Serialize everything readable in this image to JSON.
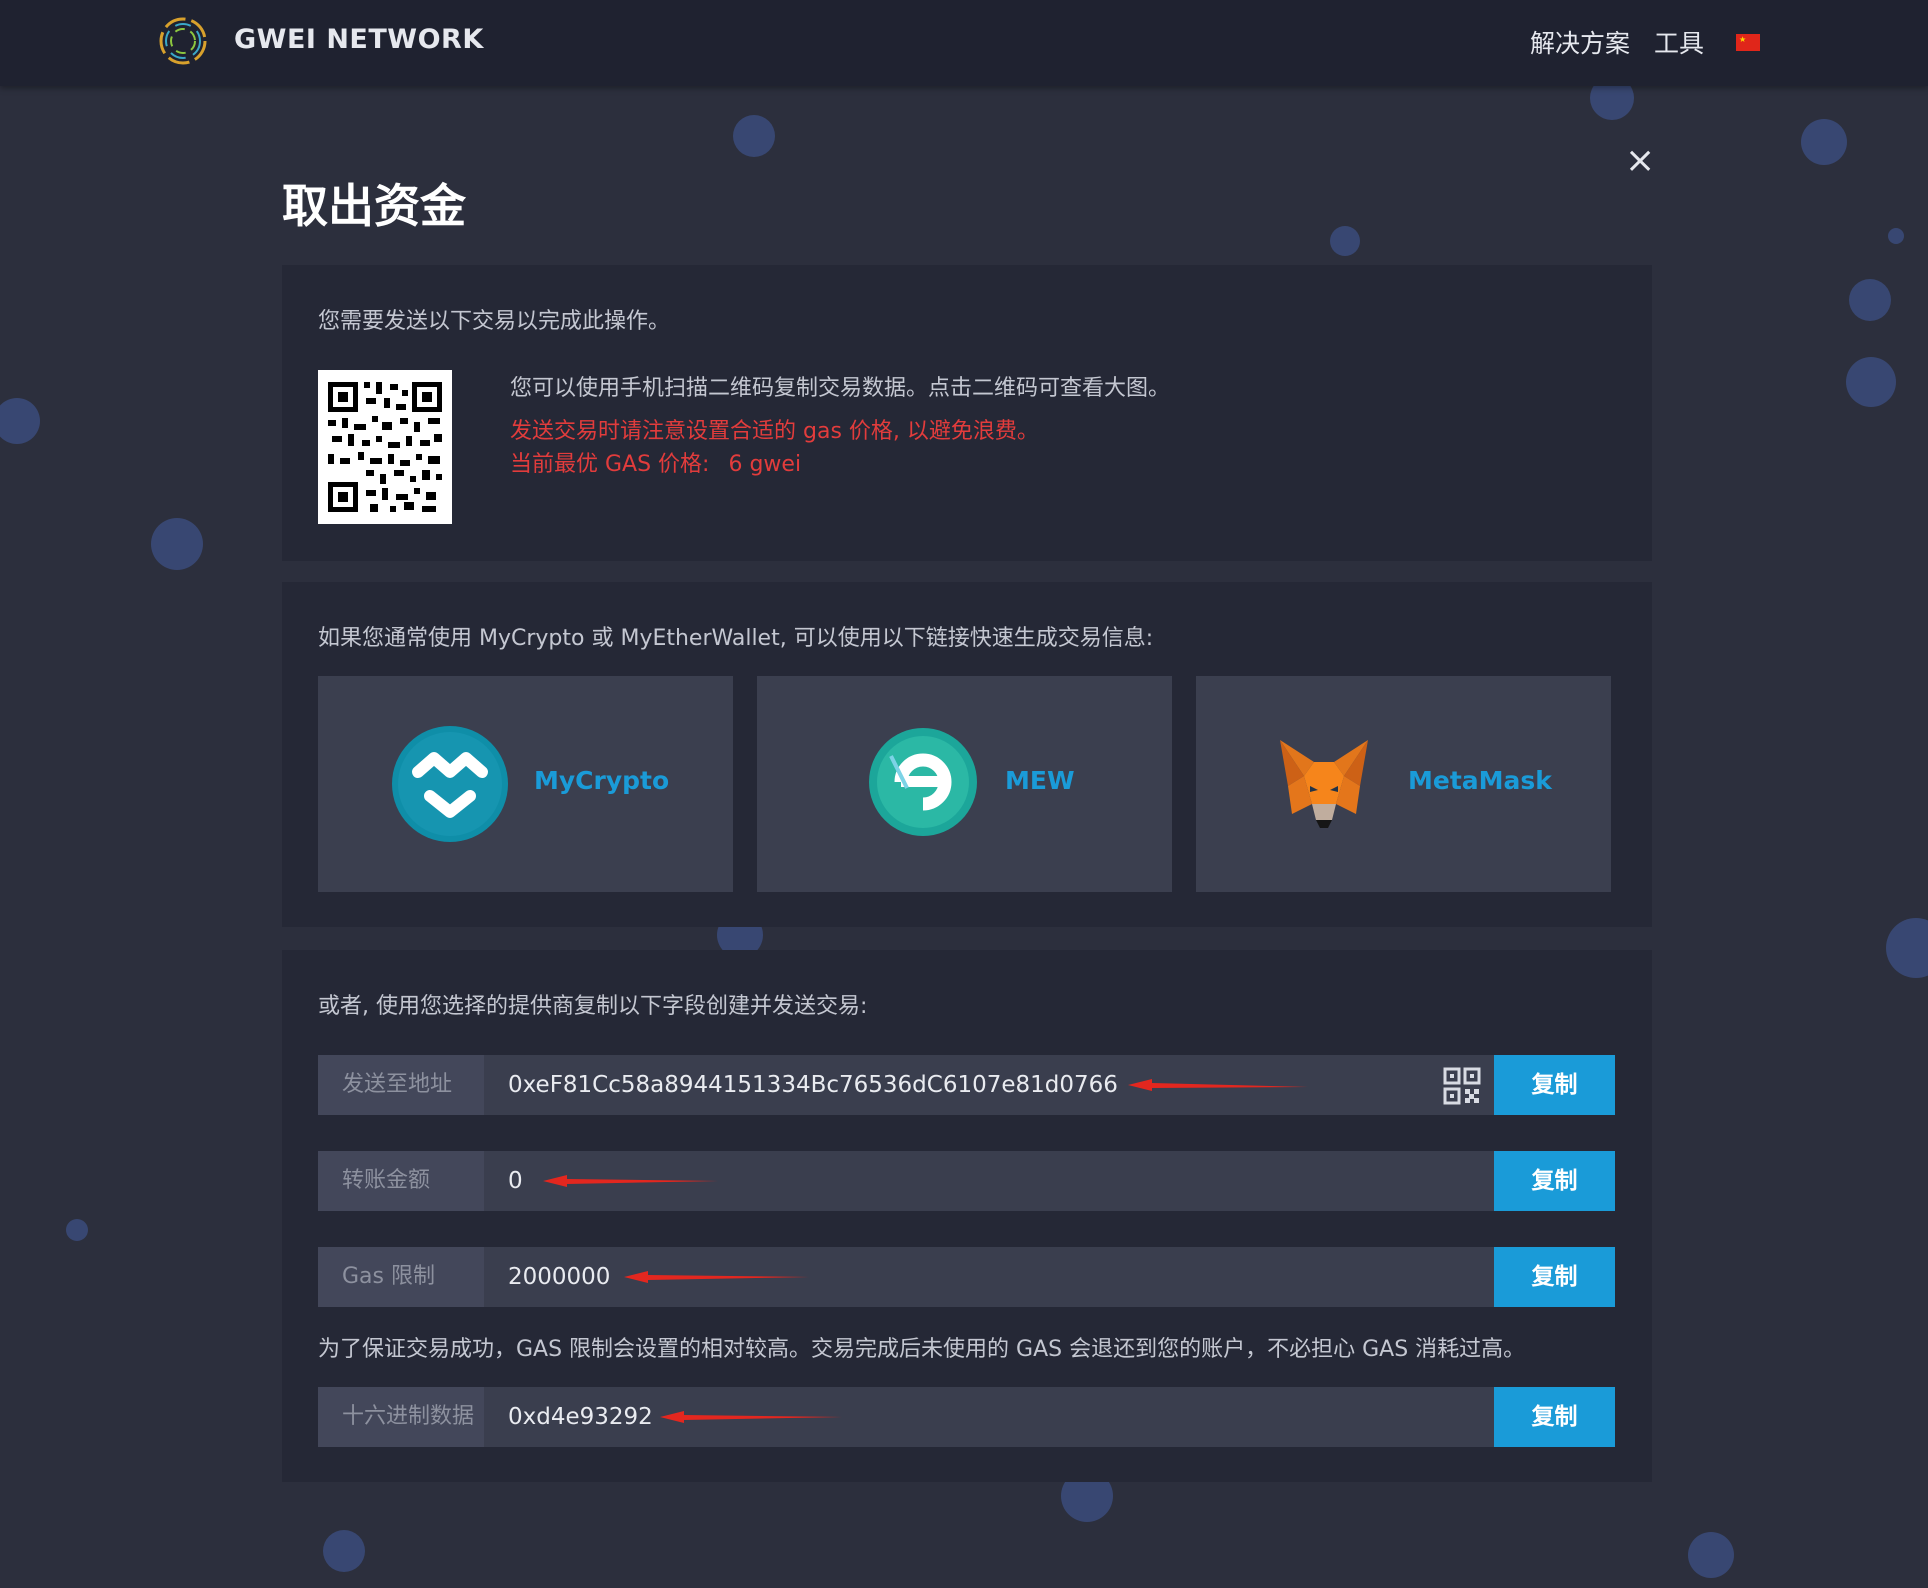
{
  "header": {
    "brand": "GWEI NETWORK",
    "nav_solutions": "解决方案",
    "nav_tools": "工具",
    "flag_icon": "china-flag-icon"
  },
  "modal": {
    "title": "取出资金",
    "close_icon": "×"
  },
  "section_qr": {
    "intro": "您需要发送以下交易以完成此操作。",
    "scan_hint": "您可以使用手机扫描二维码复制交易数据。点击二维码可查看大图。",
    "gas_warning": "发送交易时请注意设置合适的 gas 价格, 以避免浪费。",
    "gas_price_label": "当前最优 GAS 价格:",
    "gas_price_value": "6 gwei"
  },
  "section_wallets": {
    "intro": "如果您通常使用 MyCrypto 或 MyEtherWallet, 可以使用以下链接快速生成交易信息:",
    "wallets": [
      {
        "label": "MyCrypto",
        "icon": "mycrypto-icon"
      },
      {
        "label": "MEW",
        "icon": "mew-icon"
      },
      {
        "label": "MetaMask",
        "icon": "metamask-fox-icon"
      }
    ]
  },
  "section_fields": {
    "intro": "或者, 使用您选择的提供商复制以下字段创建并发送交易:",
    "copy_label": "复制",
    "fields": [
      {
        "label": "发送至地址",
        "value": "0xeF81Cc58a8944151334Bc76536dC6107e81d0766"
      },
      {
        "label": "转账金额",
        "value": "0"
      },
      {
        "label": "Gas 限制",
        "value": "2000000"
      },
      {
        "label": "十六进制数据",
        "value": "0xd4e93292"
      }
    ],
    "gas_note": "为了保证交易成功，GAS 限制会设置的相对较高。交易完成后未使用的 GAS 会退还到您的账户，不必担心 GAS 消耗过高。"
  },
  "colors": {
    "accent": "#1a9bd8",
    "warning": "#e23c3c",
    "background": "#2c2f3d",
    "panel": "#252836"
  }
}
